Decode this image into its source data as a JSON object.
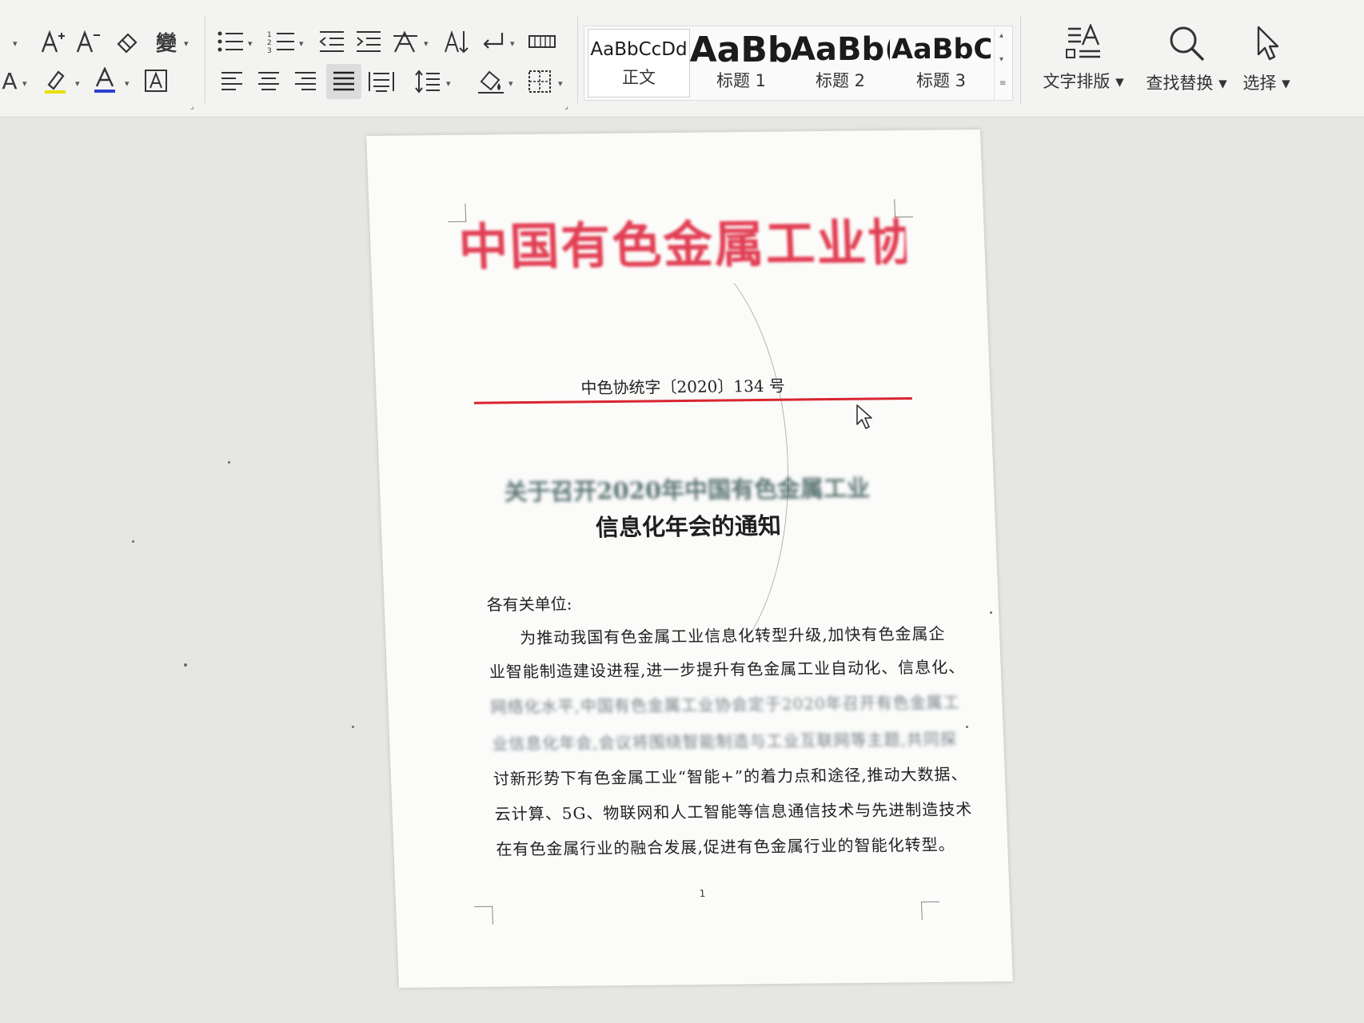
{
  "ribbon": {
    "paragraph_group": {},
    "styles": [
      {
        "sample": "AaBbCcDd",
        "label": "正文"
      },
      {
        "sample": "AaBb",
        "label": "标题 1"
      },
      {
        "sample": "AaBb(",
        "label": "标题 2"
      },
      {
        "sample": "AaBbC(",
        "label": "标题 3"
      }
    ],
    "commands": {
      "text_layout": "文字排版",
      "find_replace": "查找替换",
      "select": "选择"
    },
    "font_color": "#2f3fd1",
    "highlight_color": "#e8e000"
  },
  "document": {
    "masthead": "中国有色金属工业协会文件",
    "doc_number": "中色协统字〔2020〕134 号",
    "title_line1_obscured": "关于召开2020年中国有色金属工业",
    "title_line2": "信息化年会的通知",
    "salutation": "各有关单位:",
    "body_lines": [
      "为推动我国有色金属工业信息化转型升级,加快有色金属企",
      "业智能制造建设进程,进一步提升有色金属工业自动化、信息化、",
      "网络化水平,中国有色金属工业协会定于2020年召开有色金属工",
      "业信息化年会,会议将围绕智能制造与工业互联网等主题,共同探",
      "讨新形势下有色金属工业“智能+”的着力点和途径,推动大数据、",
      "云计算、5G、物联网和人工智能等信息通信技术与先进制造技术",
      "在有色金属行业的融合发展,促进有色金属行业的智能化转型。"
    ],
    "page_number": "1",
    "masthead_color": "#e03046",
    "rule_color": "#d9242e"
  }
}
